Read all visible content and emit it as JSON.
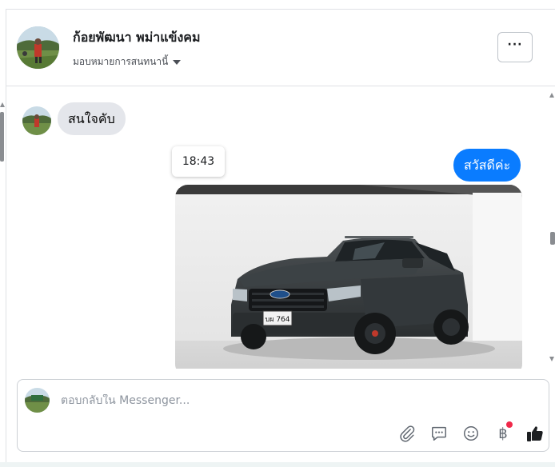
{
  "header": {
    "page_name": "ก้อยพัฒนา พม่าแข้งคม",
    "assign_label": "มอบหมายการสนทนานี้",
    "more_label": "···"
  },
  "messages": [
    {
      "direction": "incoming",
      "text": "สนใจคับ"
    },
    {
      "direction": "outgoing",
      "text": "สวัสดีค่ะ"
    }
  ],
  "timestamp_tooltip": "18:43",
  "photo": {
    "plate_text": "บผ 764"
  },
  "composer": {
    "placeholder": "ตอบกลับใน Messenger...",
    "tools": [
      "paperclip-icon",
      "saved-reply-icon",
      "emoji-icon",
      "baht-payment-icon",
      "like-icon"
    ],
    "baht_symbol": "฿"
  },
  "colors": {
    "outgoing_bubble": "#0a7cff",
    "incoming_bubble": "#e4e6eb",
    "notification_dot": "#f02849"
  }
}
